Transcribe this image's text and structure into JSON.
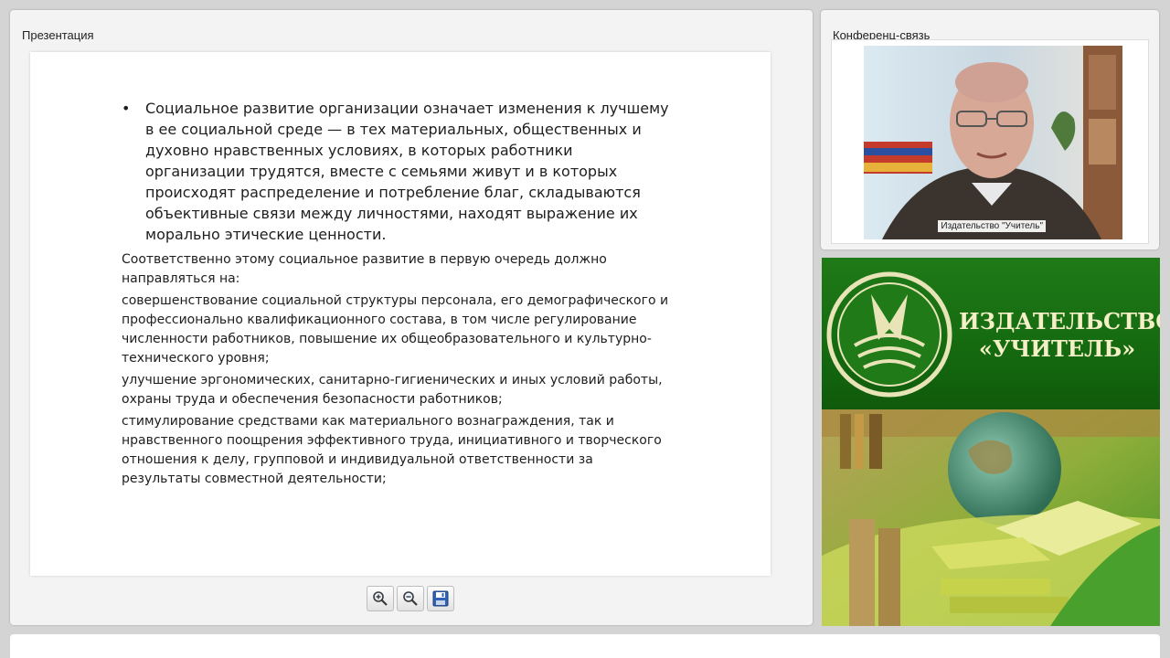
{
  "presentation": {
    "title": "Презентация",
    "slide": {
      "bullet": "Социальное развитие организации означает изменения к лучшему в ее социальной среде — в тех материальных, общественных и духовно нравственных условиях, в которых работники организации трудятся, вместе с семьями живут и в которых происходят распределение и потребление благ, складываются объективные связи между личностями, находят выражение их морально этические ценности.",
      "paragraphs": [
        "Соответственно этому социальное развитие в первую очередь должно направляться на:",
        "совершенствование социальной структуры персонала, его демографического и профессионально квалификационного состава, в том числе регулирование численности работников, повышение их общеобразовательного и культурно-технического уровня;",
        "улучшение эргономических, санитарно-гигиенических и иных условий работы, охраны труда и обеспечения безопасности работников;",
        "стимулирование средствами как материального вознаграждения, так и нравственного поощрения эффективного труда, инициативного и творческого отношения к делу, групповой и индивидуальной ответственности за результаты совместной деятельности;"
      ]
    },
    "toolbar": {
      "icons": [
        "zoom-in-icon",
        "zoom-out-icon",
        "save-icon"
      ]
    }
  },
  "conference": {
    "title": "Конференц-связь",
    "participant_label": "Издательство \"Учитель\""
  },
  "banner": {
    "line1": "ИЗДАТЕЛЬСТВО",
    "line2": "«УЧИТЕЛЬ»"
  },
  "colors": {
    "banner_green": "#156a10",
    "banner_text": "#f4efc6"
  }
}
